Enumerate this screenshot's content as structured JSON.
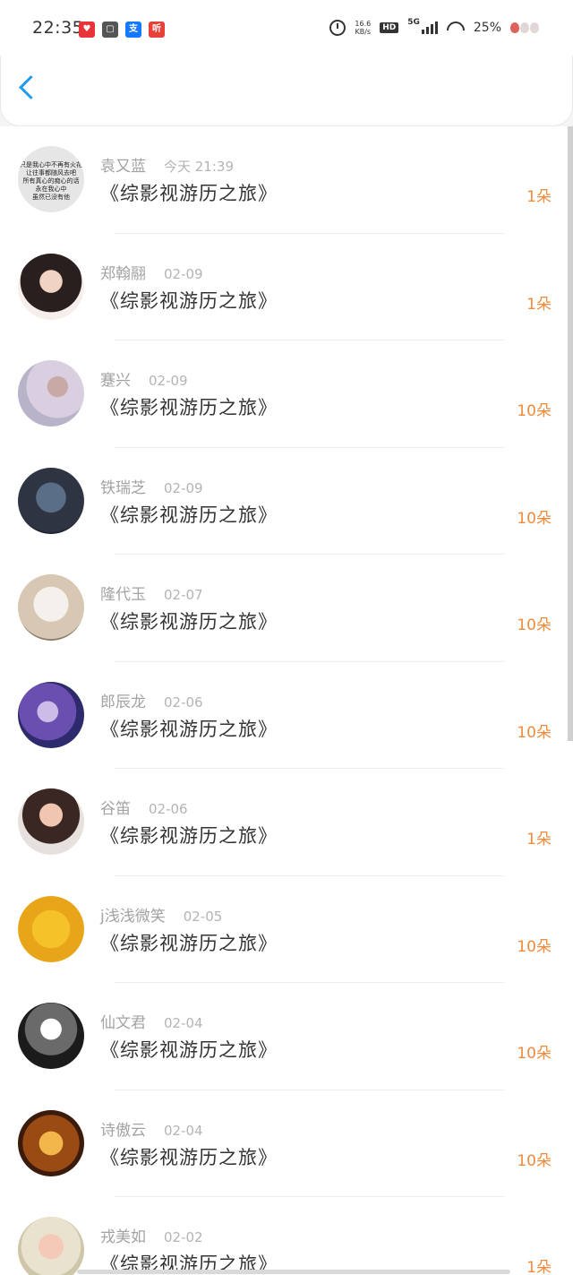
{
  "status_bar": {
    "time": "22:35",
    "net_speed_value": "16.6",
    "net_speed_unit": "KB/s",
    "hd_label": "HD",
    "network_label": "5G",
    "battery": "25%"
  },
  "header": {
    "back_icon": "chevron-left-icon"
  },
  "entries": [
    {
      "name": "袁又蓝",
      "date": "今天 21:39",
      "book": "《综影视游历之旅》",
      "gift": "1朵",
      "avatar_text": "只是我心中不再有火花\n让往事都随风去吧\n所有真心的痴心的话\n永在我心中\n虽然已没有他"
    },
    {
      "name": "郑翰翮",
      "date": "02-09",
      "book": "《综影视游历之旅》",
      "gift": "1朵"
    },
    {
      "name": "蹇兴",
      "date": "02-09",
      "book": "《综影视游历之旅》",
      "gift": "10朵"
    },
    {
      "name": "铁瑞芝",
      "date": "02-09",
      "book": "《综影视游历之旅》",
      "gift": "10朵"
    },
    {
      "name": "隆代玉",
      "date": "02-07",
      "book": "《综影视游历之旅》",
      "gift": "10朵"
    },
    {
      "name": "郎辰龙",
      "date": "02-06",
      "book": "《综影视游历之旅》",
      "gift": "10朵"
    },
    {
      "name": "谷笛",
      "date": "02-06",
      "book": "《综影视游历之旅》",
      "gift": "1朵"
    },
    {
      "name": "j浅浅微笑",
      "date": "02-05",
      "book": "《综影视游历之旅》",
      "gift": "10朵"
    },
    {
      "name": "仙文君",
      "date": "02-04",
      "book": "《综影视游历之旅》",
      "gift": "10朵"
    },
    {
      "name": "诗傲云",
      "date": "02-04",
      "book": "《综影视游历之旅》",
      "gift": "10朵"
    },
    {
      "name": "戎美如",
      "date": "02-02",
      "book": "《综影视游历之旅》",
      "gift": "1朵"
    }
  ],
  "colors": {
    "accent_blue": "#1e9bf0",
    "gift_orange": "#f08a3c"
  }
}
